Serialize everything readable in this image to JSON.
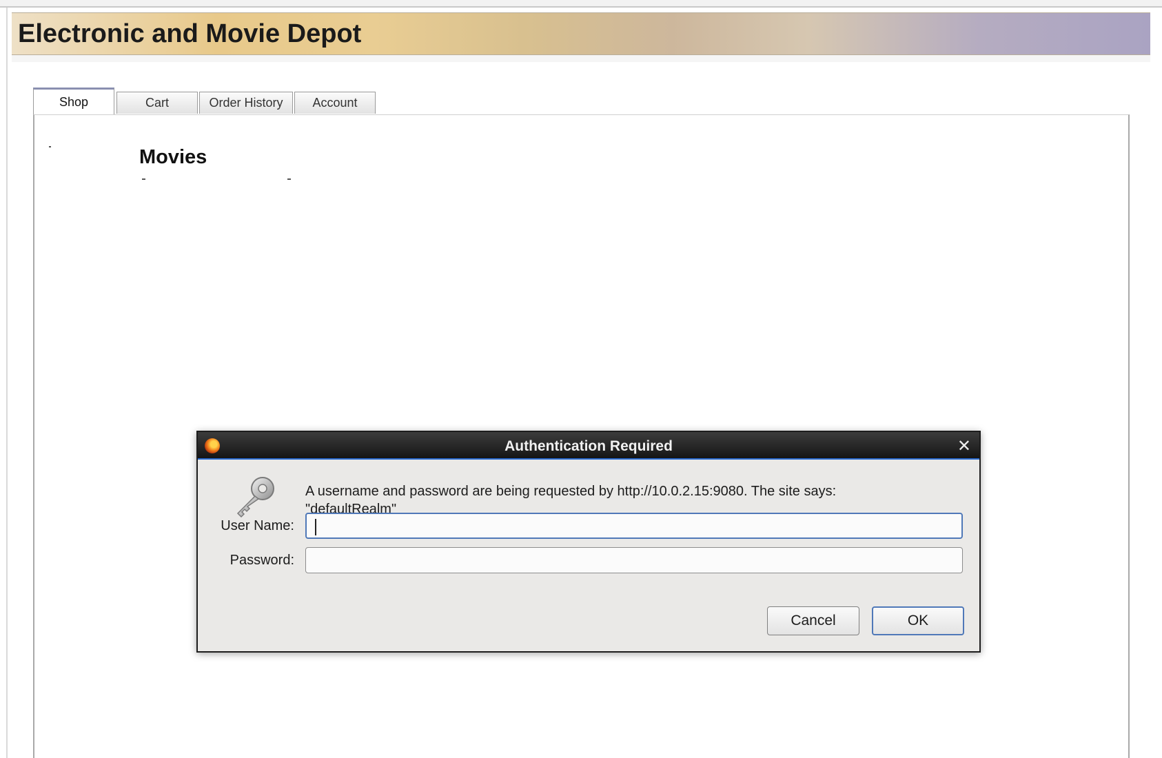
{
  "site": {
    "title": "Electronic and Movie Depot"
  },
  "tabs": [
    {
      "label": "Shop",
      "active": true
    },
    {
      "label": "Cart",
      "active": false
    },
    {
      "label": "Order History",
      "active": false
    },
    {
      "label": "Account",
      "active": false
    }
  ],
  "content": {
    "heading": "Movies"
  },
  "dialog": {
    "title": "Authentication Required",
    "message": "A username and password are being requested by http://10.0.2.15:9080. The site says: \"defaultRealm\"",
    "username_label": "User Name:",
    "username_value": "",
    "password_label": "Password:",
    "password_value": "",
    "cancel_label": "Cancel",
    "ok_label": "OK",
    "close_glyph": "✕",
    "icons": {
      "app": "firefox-icon",
      "key": "key-icon"
    }
  },
  "colors": {
    "dialog_titlebar": "#1d1d1d",
    "focus_border": "#4f78b8",
    "dialog_bg": "#eae9e7"
  }
}
